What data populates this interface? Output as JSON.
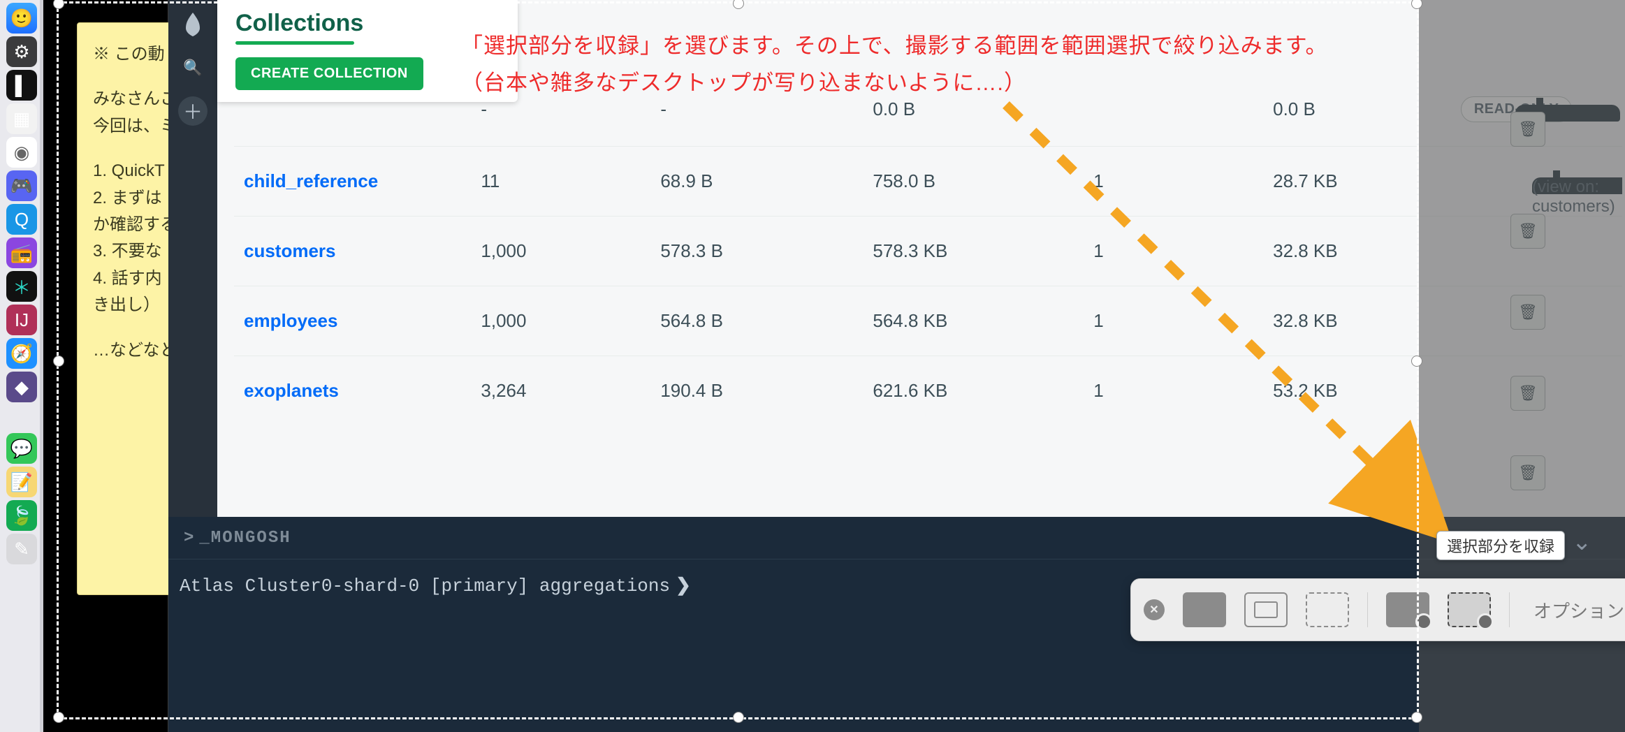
{
  "dock_icons": [
    "finder",
    "settings",
    "terminal",
    "launchpad",
    "chrome",
    "discord",
    "quicktime",
    "podcasts",
    "snowflake",
    "intellij",
    "safari",
    "obsidian",
    "messages",
    "stickies",
    "mongodb",
    "notes"
  ],
  "note": {
    "l1": "※ この動",
    "l2": "みなさんこ\n今回は、ミ",
    "l3": "1. QuickT\n2. まずは\nか確認する\n3. 不要な\n4. 話す内\nき出し）",
    "l4": "…などなと"
  },
  "annotation": {
    "line1": "「選択部分を収録」を選びます。その上で、撮影する範囲を範囲選択で絞り込みます。",
    "line2": "（台本や雑多なデスクトップが写り込まないように….）"
  },
  "compass": {
    "title": "Collections",
    "create_label": "CREATE COLLECTION",
    "rows": [
      {
        "name": "",
        "sub": "(view on: customers)",
        "docs": "-",
        "avg": "-",
        "total": "0.0 B",
        "idx": "",
        "idxsize": "0.0 B",
        "readonly": true
      },
      {
        "name": "child_reference",
        "docs": "11",
        "avg": "68.9 B",
        "total": "758.0 B",
        "idx": "1",
        "idxsize": "28.7 KB"
      },
      {
        "name": "customers",
        "docs": "1,000",
        "avg": "578.3 B",
        "total": "578.3 KB",
        "idx": "1",
        "idxsize": "32.8 KB"
      },
      {
        "name": "employees",
        "docs": "1,000",
        "avg": "564.8 B",
        "total": "564.8 KB",
        "idx": "1",
        "idxsize": "32.8 KB"
      },
      {
        "name": "exoplanets",
        "docs": "3,264",
        "avg": "190.4 B",
        "total": "621.6 KB",
        "idx": "1",
        "idxsize": "53.2 KB"
      }
    ],
    "readonly_label": "READ-ONLY"
  },
  "mongosh": {
    "header": "_MONGOSH",
    "prompt": "Atlas Cluster0-shard-0 [primary] aggregations",
    "caret": "❯"
  },
  "tooltip": "選択部分を収録",
  "qt": {
    "options_label": "オプション"
  }
}
